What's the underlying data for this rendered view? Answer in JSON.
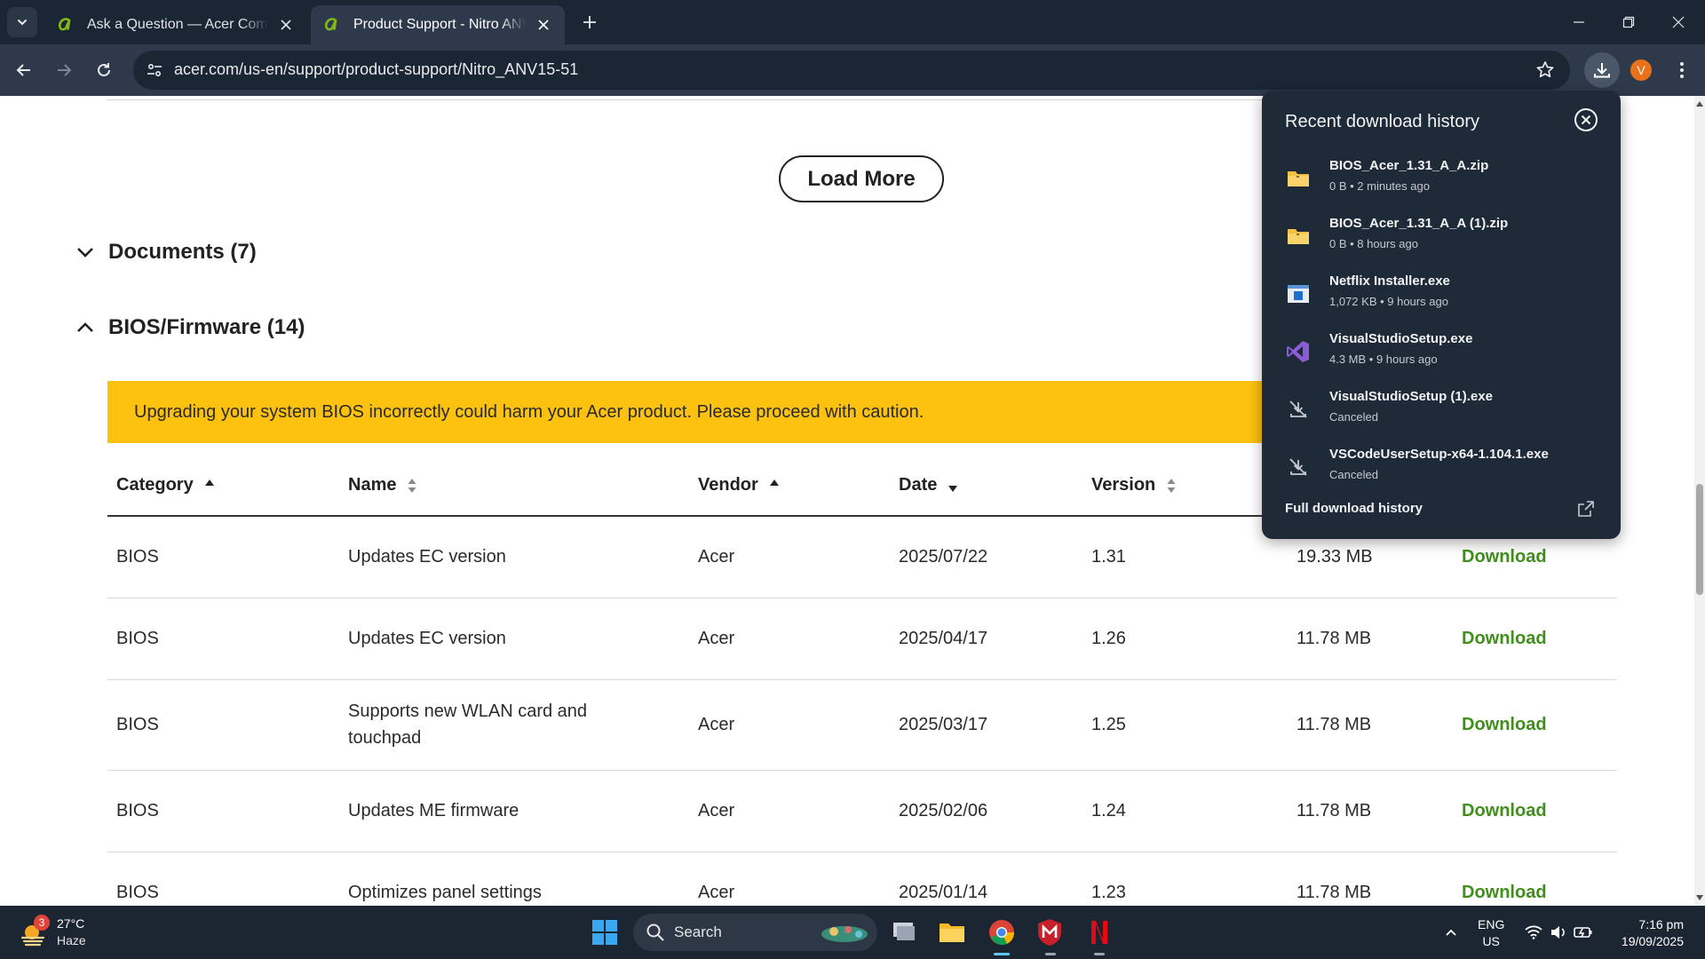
{
  "tabs": [
    {
      "title": "Ask a Question — Acer Community",
      "active": false
    },
    {
      "title": "Product Support - Nitro ANV15-51",
      "active": true
    }
  ],
  "toolbar": {
    "url": "acer.com/us-en/support/product-support/Nitro_ANV15-51",
    "profile_initial": "V"
  },
  "page": {
    "load_more_label": "Load More",
    "sections": [
      {
        "label": "Documents (7)",
        "expanded": false
      },
      {
        "label": "BIOS/Firmware (14)",
        "expanded": true
      }
    ],
    "warning": "Upgrading your system BIOS incorrectly could harm your Acer product. Please proceed with caution.",
    "table": {
      "headers": {
        "category": "Category",
        "name": "Name",
        "vendor": "Vendor",
        "date": "Date",
        "version": "Version"
      },
      "rows": [
        {
          "category": "BIOS",
          "name": "Updates EC version",
          "vendor": "Acer",
          "date": "2025/07/22",
          "version": "1.31",
          "size": "19.33 MB",
          "action": "Download"
        },
        {
          "category": "BIOS",
          "name": "Updates EC version",
          "vendor": "Acer",
          "date": "2025/04/17",
          "version": "1.26",
          "size": "11.78 MB",
          "action": "Download"
        },
        {
          "category": "BIOS",
          "name": "Supports new WLAN card and touchpad",
          "vendor": "Acer",
          "date": "2025/03/17",
          "version": "1.25",
          "size": "11.78 MB",
          "action": "Download"
        },
        {
          "category": "BIOS",
          "name": "Updates ME firmware",
          "vendor": "Acer",
          "date": "2025/02/06",
          "version": "1.24",
          "size": "11.78 MB",
          "action": "Download"
        },
        {
          "category": "BIOS",
          "name": "Optimizes panel settings",
          "vendor": "Acer",
          "date": "2025/01/14",
          "version": "1.23",
          "size": "11.78 MB",
          "action": "Download"
        }
      ]
    }
  },
  "downloads": {
    "title": "Recent download history",
    "items": [
      {
        "name": "BIOS_Acer_1.31_A_A.zip",
        "meta": "0 B • 2 minutes ago",
        "icon": "folder-zip-icon"
      },
      {
        "name": "BIOS_Acer_1.31_A_A (1).zip",
        "meta": "0 B • 8 hours ago",
        "icon": "folder-zip-icon"
      },
      {
        "name": "Netflix Installer.exe",
        "meta": "1,072 KB • 9 hours ago",
        "icon": "installer-icon"
      },
      {
        "name": "VisualStudioSetup.exe",
        "meta": "4.3 MB • 9 hours ago",
        "icon": "visual-studio-icon"
      },
      {
        "name": "VisualStudioSetup (1).exe",
        "meta": "Canceled",
        "icon": "download-canceled-icon"
      },
      {
        "name": "VSCodeUserSetup-x64-1.104.1.exe",
        "meta": "Canceled",
        "icon": "download-canceled-icon"
      }
    ],
    "full_history": "Full download history"
  },
  "taskbar": {
    "weather_badge": "3",
    "temperature": "27°C",
    "condition": "Haze",
    "search_label": "Search",
    "lang_line1": "ENG",
    "lang_line2": "US",
    "time": "7:16 pm",
    "date": "19/09/2025"
  },
  "colors": {
    "warning_bg": "#fdc10f",
    "download_link": "#3f8f1a",
    "chrome_dark": "#1b2634",
    "chrome_toolbar": "#2e3a4c"
  }
}
